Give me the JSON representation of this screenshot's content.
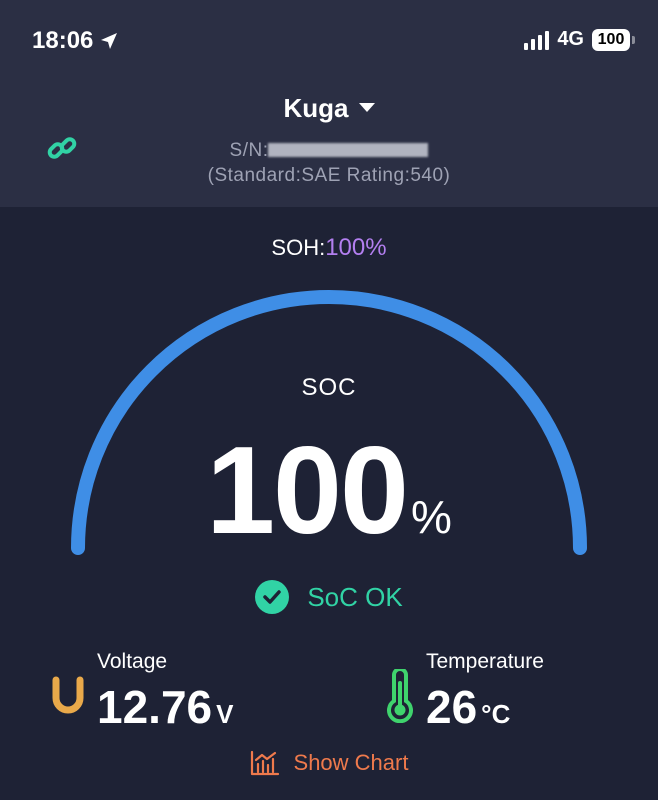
{
  "status_bar": {
    "time": "18:06",
    "network": "4G",
    "battery": "100"
  },
  "header": {
    "vehicle_name": "Kuga",
    "serial_prefix": "S/N:",
    "standard_text": "(Standard:SAE  Rating:540)"
  },
  "soh": {
    "label": "SOH:",
    "value": "100%"
  },
  "soc": {
    "label": "SOC",
    "value": "100",
    "unit": "%",
    "fraction": 1.0,
    "status": "SoC OK"
  },
  "voltage": {
    "label": "Voltage",
    "value": "12.76",
    "unit": "V"
  },
  "temperature": {
    "label": "Temperature",
    "value": "26",
    "unit": "°C"
  },
  "actions": {
    "show_chart": "Show Chart"
  },
  "colors": {
    "background": "#1e2235",
    "header": "#2b2f44",
    "gauge": "#3f8ee6",
    "soh_accent": "#b37ff0",
    "ok_green": "#31d3a5",
    "voltage_icon": "#e9a94a",
    "temperature_icon": "#3fd36d",
    "chart_orange": "#ef7a4c"
  },
  "icons": [
    "location-arrow-icon",
    "signal-icon",
    "battery-icon",
    "link-icon",
    "dropdown-caret-icon",
    "check-circle-icon",
    "voltage-icon",
    "thermometer-icon",
    "chart-icon"
  ]
}
